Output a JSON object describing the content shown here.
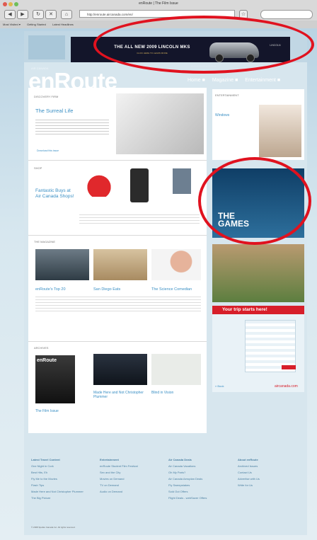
{
  "browser": {
    "window_title": "enRoute | The Film Issue",
    "url": "http://enroute.aircanada.com/en/",
    "bookmarks": [
      "Most Visited ▾",
      "Getting Started",
      "Latest Headlines"
    ]
  },
  "ads": {
    "top_banner": "THE ALL NEW 2009 LINCOLN MKS",
    "top_banner_sub": "CLICK HERE TO LEARN MORE",
    "top_banner_brand": "LINCOLN",
    "right_ad_title_line1": "THE",
    "right_ad_title_line2": "GAMES",
    "trip_title": "Your trip starts here!",
    "trip_brand": "aircanada.com",
    "trip_link": "» Book"
  },
  "site": {
    "logo": "enRoute",
    "edition": "AIR CANADA",
    "nav": [
      "Home ■",
      "Magazine ■",
      "Entertainment ■"
    ]
  },
  "columns": {
    "discovery_label": "DISCOVERY FIRM",
    "feature_title": "The Surreal Life",
    "feature_more": "Download this issue",
    "shop_label": "SHOP",
    "shop_title": "Fantastic Buys at Air Canada Shops!",
    "mag_label": "THE MAGAZINE",
    "mag_items": [
      "enRoute's Top 20",
      "San Diego Eats",
      "The Science Comedian"
    ],
    "archive_label": "ARCHIVES",
    "archive_items": [
      "The Film Issue",
      "Made Here and Not Christopher Plummer",
      "Blind in Vision"
    ],
    "entertainment_label": "ENTERTAINMENT",
    "ent_title": "Windows"
  },
  "footer": {
    "cols": [
      {
        "head": "Latest Travel Content",
        "items": [
          "One Night in Cork",
          "Best Hits, Eh",
          "Fly Me to the Movies",
          "Flash Tips",
          "Made Here and Not Christopher Plummer",
          "The Big Picture"
        ]
      },
      {
        "head": "Entertainment",
        "items": [
          "enRoute Student Film Festival",
          "Sex and the City",
          "Movies on Demand",
          "TV on Demand",
          "Audio on Demand"
        ]
      },
      {
        "head": "Air Canada Deals",
        "items": [
          "Air Canada Vacations",
          "Oh My Paris?",
          "Air Canada Aeroplan Deals",
          "Fly Sweepstakes",
          "Sold Out Offers",
          "Flight Deals - webSaver Offers"
        ]
      },
      {
        "head": "About enRoute",
        "items": [
          "Archived Issues",
          "Contact Us",
          "Advertise with Us",
          "Write for Us"
        ]
      }
    ],
    "copyright": "© 2008 Spafax Canada Inc. All rights reserved."
  },
  "colors": {
    "accent": "#3a8fc4",
    "oval": "#e0121f",
    "ad_navy": "#13152a"
  }
}
